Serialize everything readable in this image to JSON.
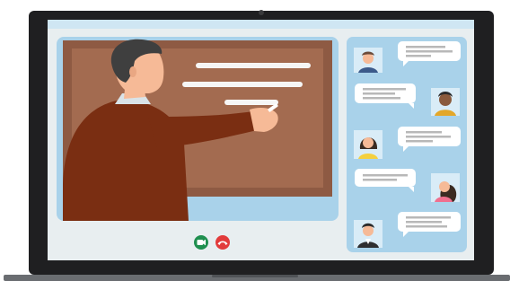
{
  "colors": {
    "laptop_bezel": "#1f1f21",
    "screen_bg": "#e8eef0",
    "screen_topbar": "#cfe6f3",
    "video_frame": "#a9d2ea",
    "chalkboard": "#8e5a43",
    "chalkboard_inner": "#a36b50",
    "chalk_lines": "#f6f6f6",
    "chat_panel": "#a9d2ea",
    "bubble": "#ffffff",
    "bubble_lines": "#b8b8b8",
    "video_button": "#1f8f4f",
    "end_call_button": "#e23b3b",
    "laptop_base": "#6a6d71"
  },
  "video_call": {
    "main_video_subject": "teacher-at-chalkboard",
    "controls": {
      "video_icon": "camera-icon",
      "end_call_icon": "phone-hangup-icon"
    }
  },
  "chat": {
    "participants": [
      {
        "avatar": "participant-1-avatar",
        "side": "left"
      },
      {
        "avatar": "participant-2-avatar",
        "side": "right"
      },
      {
        "avatar": "participant-3-avatar",
        "side": "left"
      },
      {
        "avatar": "participant-4-avatar",
        "side": "right"
      },
      {
        "avatar": "participant-5-avatar",
        "side": "left"
      }
    ]
  }
}
